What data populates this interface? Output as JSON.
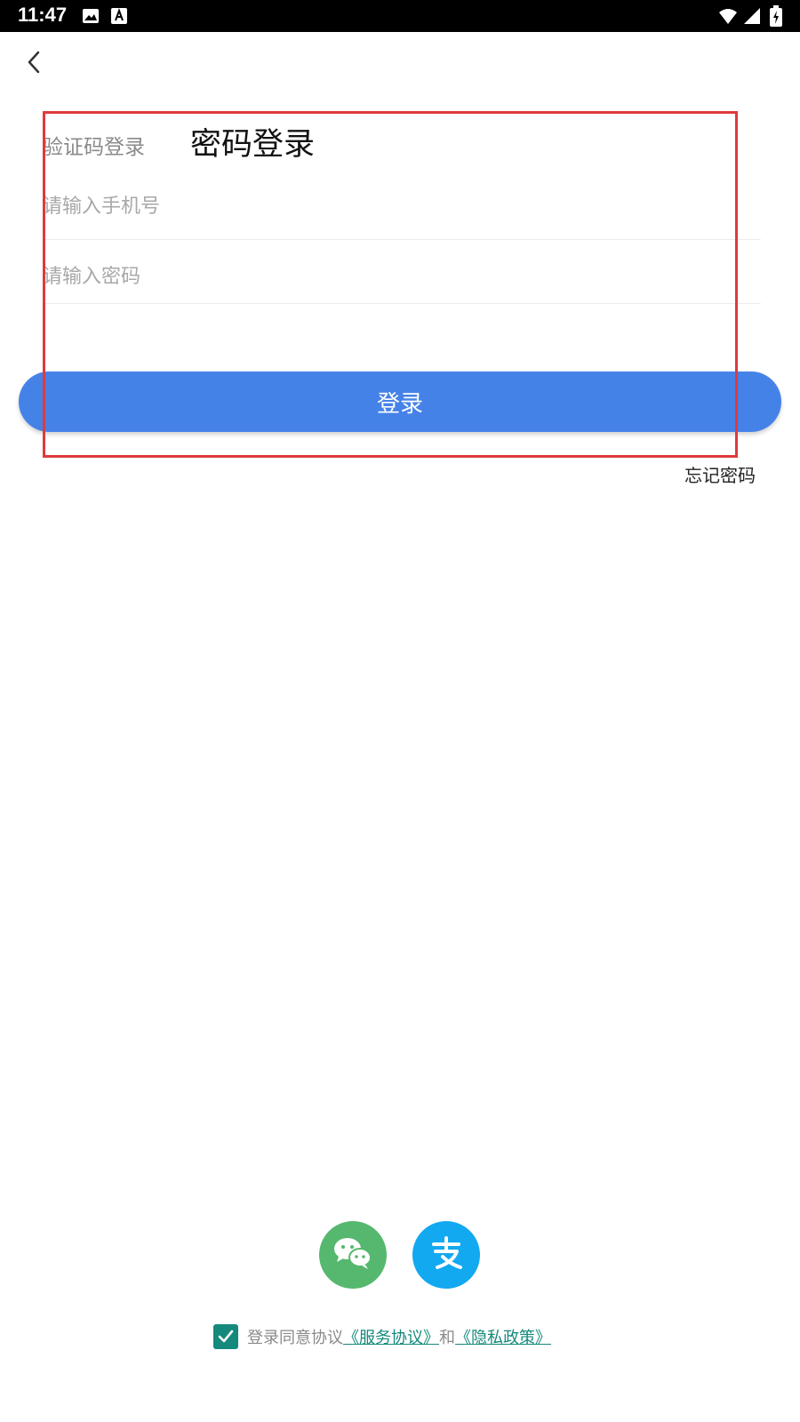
{
  "status_bar": {
    "time": "11:47",
    "icons": [
      "image-icon",
      "a-badge-icon",
      "wifi-icon",
      "signal-icon",
      "battery-icon"
    ]
  },
  "nav": {
    "back_icon": "chevron-left-icon"
  },
  "tabs": {
    "sms_label": "验证码登录",
    "password_label": "密码登录"
  },
  "form": {
    "phone_placeholder": "请输入手机号",
    "password_placeholder": "请输入密码",
    "login_label": "登录",
    "forgot_label": "忘记密码"
  },
  "social": {
    "wechat_icon": "wechat-icon",
    "alipay_icon": "alipay-icon",
    "wechat_color": "#55b86e",
    "alipay_color": "#12a9f0"
  },
  "agreement": {
    "checked": true,
    "prefix": "登录同意协议",
    "service_link": "《服务协议》",
    "joiner": "和",
    "privacy_link": "《隐私政策》"
  },
  "colors": {
    "primary_blue": "#4582e8",
    "teal": "#15897b",
    "highlight_red": "#e0393e"
  }
}
